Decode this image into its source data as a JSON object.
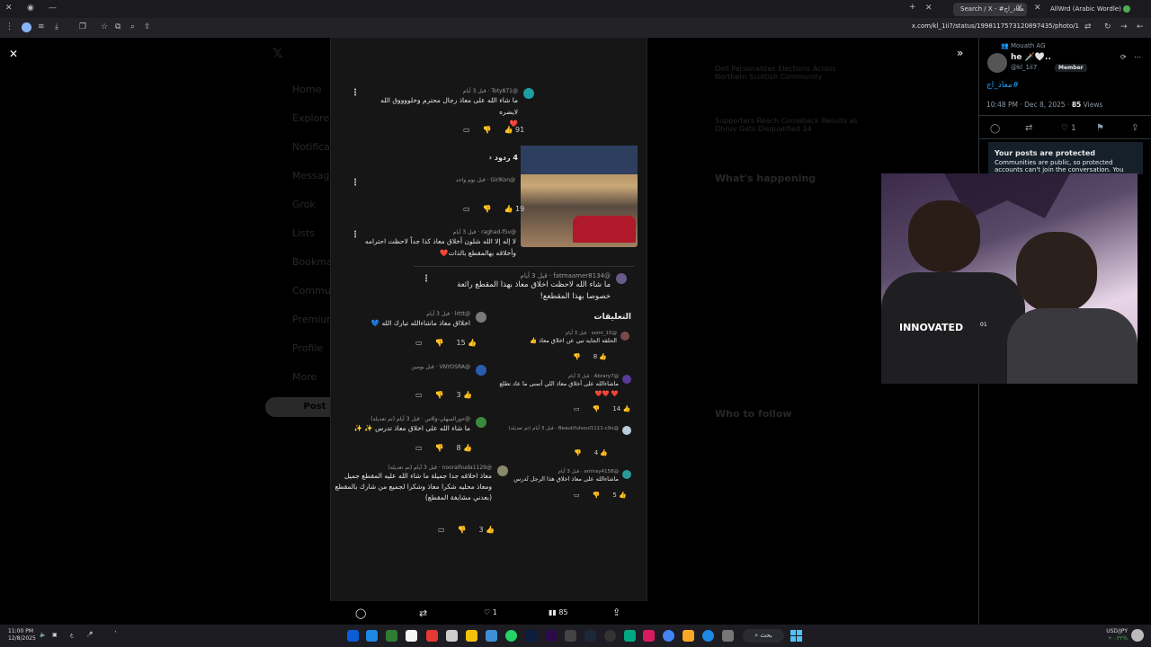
{
  "browser": {
    "tabs": [
      {
        "label": "Search / X - #معاد_اج"
      },
      {
        "label": "AllWrd (Arabic Wordle) - الورد"
      }
    ],
    "url": "x.com/kl_1ii7/status/1998117573120897435/photo/1"
  },
  "phone": {
    "replies_toggle": "4 ردود",
    "comments_heading": "التعليقات",
    "comments": [
      {
        "user": "@Toty871",
        "time": "قبل 3 أيام",
        "text": "ما شاء الله على معاذ رجال محترم وخلووووق الله لايضره",
        "emoji": "❤️",
        "likes": "91"
      },
      {
        "user": "@GirlKon",
        "time": "قبل يوم واحد",
        "text": "",
        "likes": "19"
      },
      {
        "user": "@raghad-f5v",
        "time": "قبل 3 أيام",
        "text": "لا إله إلا الله شلون أخلاق معاذ كذا جداً لاحظت احترامه وأخلاقه بهالمقطع بالذات❤️",
        "likes": ""
      },
      {
        "user": "@fatmaamer8134",
        "time": "قبل 3 أيام",
        "text": "ما شاء الله لاحظت اخلاق معاذ بهذا المقطع رائعة خصوصا بهذا المقطعع!",
        "likes": ""
      },
      {
        "user": "@lrttt",
        "time": "قبل 3 أيام",
        "text": "اخلااق معاذ ماشاءالله تبارك الله 💙",
        "likes": "15"
      },
      {
        "user": "@VNYOSRA",
        "time": "قبل يومين",
        "text": "",
        "likes": "3"
      },
      {
        "user": "@حورالسهلي-ؤ6س",
        "time": "قبل 3 أيام (تم تعديله)",
        "text": "ما شاء الله على اخلاق معاذ تدرس ✨ ✨",
        "likes": "8"
      },
      {
        "user": "@nooralhuda1129",
        "time": "قبل 3 أيام (تم تعديله)",
        "text": "معاذ اخلاقه جدا جميلة ما شاء الله عليه المقطع جميل ومعاذ محليه شكرا معاذ وشكرا لجميع من شارك بالمقطع (بعدني مشايفة المقطع)",
        "likes": "3"
      },
      {
        "user": "@somi_15",
        "time": "قبل 3 أيام",
        "text": "الحلقه الجايه تبي عن اخلاق معاذ 👍",
        "likes": "8"
      },
      {
        "user": "@Abrary7",
        "time": "قبل 3 أيام",
        "text": "ماشاءالله على أخلاق معاذ اللي أتمنى ما عاد تطلع ❤️ ❤️❤️",
        "likes": "14"
      },
      {
        "user": "@Beautifulsoul1111-c9x",
        "time": "قبل 3 أيام (تم تعديله)",
        "text": "",
        "likes": "4"
      },
      {
        "user": "@amiray4158",
        "time": "قبل 3 أيام",
        "text": "ماشاءالله على معاذ اخلاق هذا الرجل تُدرس",
        "likes": "5"
      }
    ]
  },
  "actbar": {
    "likes": "1",
    "views": "85"
  },
  "panel": {
    "community": "Mouath AG",
    "name": "he 🗡️🤍..",
    "handle": "@kl_1ii7",
    "badge": "Member",
    "hashtag": "#معاذ_اج",
    "timestamp": "10:48 PM · Dec 8, 2025 ·",
    "views_count": "85",
    "views_label": "Views",
    "likes": "1",
    "protected_title": "Your posts are protected",
    "protected_text": "Communities are public, so protected accounts can't join the conversation. You"
  },
  "webcam": {
    "shirt_text": "INNOVATED",
    "shirt_num": "01"
  },
  "ghost": {
    "nav": [
      "Home",
      "Explore",
      "Notifications",
      "Messages",
      "Grok",
      "Lists",
      "Bookmarks",
      "Communities",
      "Premium",
      "Profile",
      "More"
    ],
    "post_label": "Post",
    "whats_happening": "What's happening",
    "who_to_follow": "Who to follow",
    "trend_1": "Dell Personalizes Elections Across Northern Scottish Community",
    "trend_2": "Supporters Reach Comeback Results as Dhruv Gets Disqualified 14"
  },
  "taskbar": {
    "time": "11:00 PM",
    "date": "12/8/2025",
    "search": "بحث",
    "currency": "USD/JPY",
    "currency_val": "+٠.٣٢%",
    "lang": "ع"
  }
}
